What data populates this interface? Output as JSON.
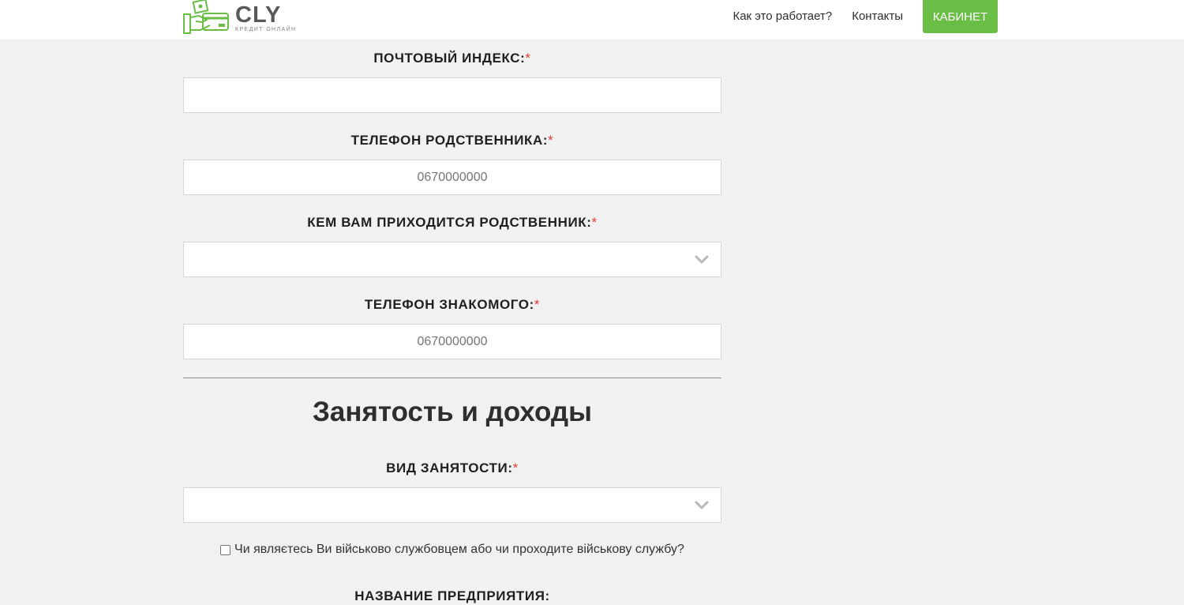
{
  "header": {
    "logo": {
      "word": "CLY",
      "subtitle": "КРЕДИТ ОНЛАЙН"
    },
    "nav": {
      "how_it_works": "Как это работает?",
      "contacts": "Контакты",
      "cabinet": "КАБИНЕТ"
    }
  },
  "form": {
    "postal_index": {
      "label": "ПОЧТОВЫЙ ИНДЕКС:",
      "required_mark": "*",
      "value": "",
      "placeholder": ""
    },
    "relative_phone": {
      "label": "ТЕЛЕФОН РОДСТВЕННИКА:",
      "required_mark": "*",
      "value": "",
      "placeholder": "0670000000"
    },
    "relative_relation": {
      "label": "КЕМ ВАМ ПРИХОДИТСЯ РОДСТВЕННИК:",
      "required_mark": "*",
      "selected": ""
    },
    "acquaintance_phone": {
      "label": "ТЕЛЕФОН ЗНАКОМОГО:",
      "required_mark": "*",
      "value": "",
      "placeholder": "0670000000"
    },
    "section_employment": {
      "title": "Занятость и доходы"
    },
    "employment_type": {
      "label": "ВИД ЗАНЯТОСТИ:",
      "required_mark": "*",
      "selected": ""
    },
    "military_checkbox": {
      "label": "Чи являєтесь Ви військово службовцем або чи проходите військову службу?",
      "checked": false
    },
    "company_name": {
      "label": "НАЗВАНИЕ ПРЕДПРИЯТИЯ:"
    }
  },
  "colors": {
    "accent_green": "#6abd45",
    "required_red": "#e53a32",
    "page_bg": "#f1f1f1"
  },
  "icons": {
    "logo": "hand-with-money-card-icon",
    "select": "chevron-down-icon"
  }
}
